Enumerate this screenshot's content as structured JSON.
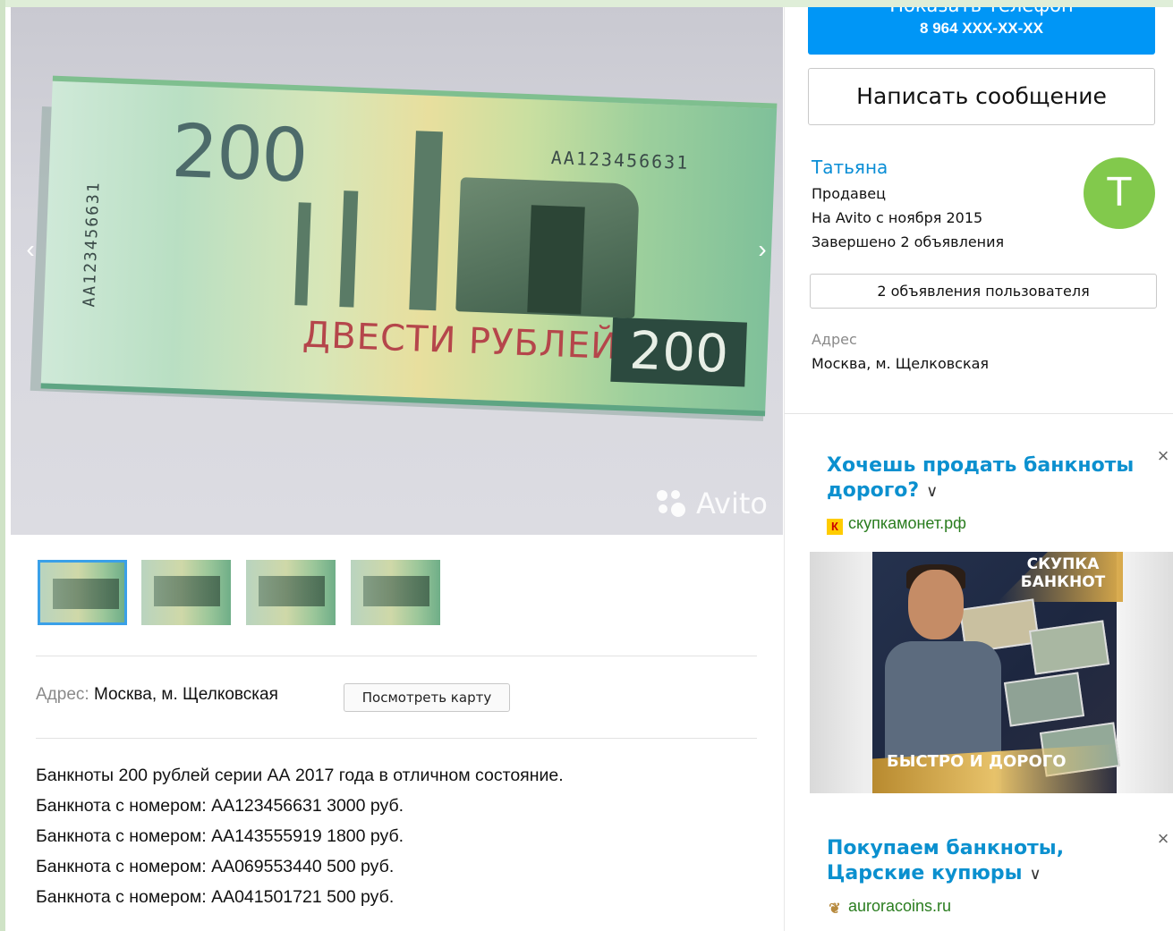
{
  "gallery": {
    "banknote": {
      "denomination": "200",
      "serial": "AA123456631",
      "words": "ДВЕСТИ РУБЛЕЙ"
    },
    "watermark": "Avito",
    "prev_arrow": "‹",
    "next_arrow": "›",
    "thumbnail_count": 4,
    "active_thumbnail": 1
  },
  "listing": {
    "address_label": "Адрес:",
    "address_value": "Москва, м. Щелковская",
    "map_button": "Посмотреть карту",
    "description": [
      "Банкноты 200 рублей серии АА 2017 года в отличном состояние.",
      "Банкнота с номером: АА123456631 3000 руб.",
      "Банкнота с номером: АА143555919 1800 руб.",
      "Банкнота с номером: АА069553440 500 руб.",
      "Банкнота с номером: АА041501721 500 руб."
    ]
  },
  "contact": {
    "show_phone_label": "Показать телефон",
    "phone": "8 964 XXX-XX-XX",
    "write_message": "Написать сообщение"
  },
  "seller": {
    "name": "Татьяна",
    "role": "Продавец",
    "since": "На Avito с ноября 2015",
    "completed": "Завершено 2 объявления",
    "avatar_letter": "T",
    "avatar_color": "#82c94c",
    "listings_button": "2 объявления пользователя",
    "address_label": "Адрес",
    "address_value": "Москва, м. Щелковская"
  },
  "ads": [
    {
      "title": "Хочешь продать банкноты дорого?",
      "domain": "скупкамонет.рф",
      "favicon": "К",
      "banner_top": "СКУПКА БАНКНОТ",
      "banner_bottom": "БЫСТРО И ДОРОГО"
    },
    {
      "title": "Покупаем банкноты, Царские купюры",
      "domain": "auroracoins.ru",
      "favicon": "❦"
    }
  ],
  "ad_chevron": "∨",
  "ad_close": "×",
  "colors": {
    "accent_blue": "#0096f6",
    "link_blue": "#0a8ed6",
    "ad_title_blue": "#0b90cf",
    "ad_domain_green": "#2a7d1f",
    "thumb_active_border": "#3aa0e8"
  }
}
